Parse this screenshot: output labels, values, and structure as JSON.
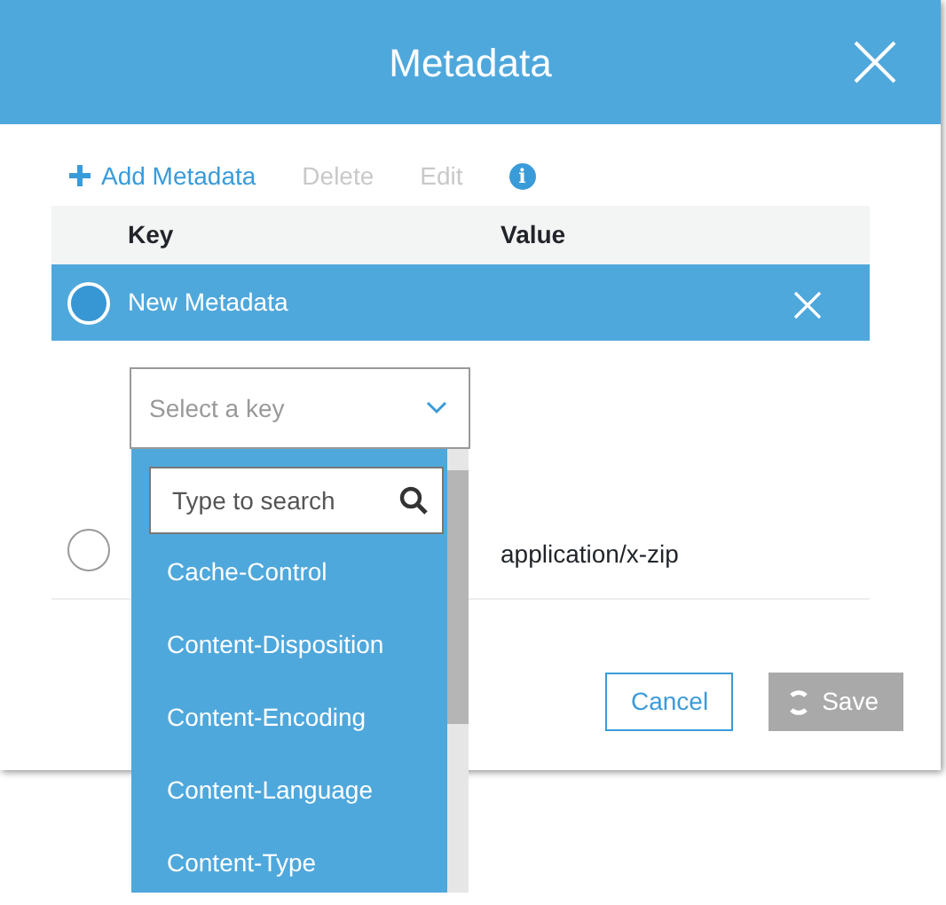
{
  "dialog": {
    "title": "Metadata"
  },
  "toolbar": [
    {
      "kind": "add",
      "label": "Add Metadata",
      "disabled": false
    },
    {
      "kind": "text",
      "label": "Delete",
      "disabled": true
    },
    {
      "kind": "text",
      "label": "Edit",
      "disabled": true
    },
    {
      "kind": "info",
      "label": "i",
      "disabled": false
    }
  ],
  "table": {
    "columns": [
      "Key",
      "Value"
    ],
    "rows": [
      {
        "key": "New Metadata",
        "selected": true
      },
      {
        "value": "application/x-zip",
        "selected": false
      }
    ]
  },
  "key_select": {
    "placeholder": "Select a key",
    "search_placeholder": "Type to search",
    "options": [
      "Cache-Control",
      "Content-Disposition",
      "Content-Encoding",
      "Content-Language",
      "Content-Type"
    ]
  },
  "buttons": [
    {
      "label": "Cancel",
      "disabled": false
    },
    {
      "label": "Save",
      "disabled": true
    }
  ]
}
